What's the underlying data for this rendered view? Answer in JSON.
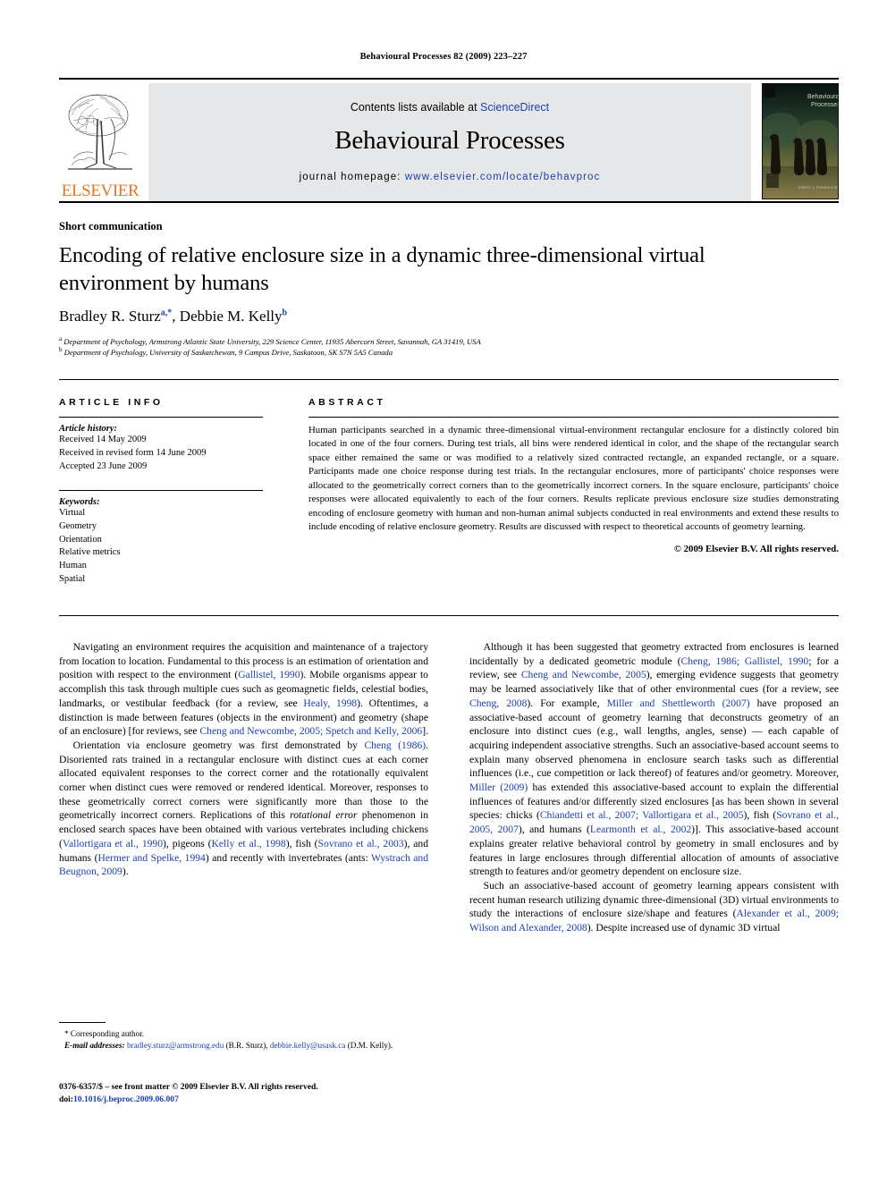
{
  "running_head": "Behavioural Processes 82 (2009) 223–227",
  "masthead": {
    "contents_prefix": "Contents lists available at ",
    "sciencedirect": "ScienceDirect",
    "journal_title": "Behavioural Processes",
    "homepage_label": "journal homepage:",
    "homepage_url": "www.elsevier.com/locate/behavproc",
    "publisher": "ELSEVIER",
    "cover_title_line1": "Behavioural",
    "cover_title_line2": "Processes",
    "accent_orange": "#E87722",
    "link_blue": "#1b3fae",
    "band_gray": "#e6e7e8"
  },
  "article": {
    "type": "Short communication",
    "title": "Encoding of relative enclosure size in a dynamic three-dimensional virtual environment by humans",
    "authors_html": "Bradley R. Sturz<sup>a,*</sup>, Debbie M. Kelly<sup>b</sup>",
    "affiliation_a": "Department of Psychology, Armstrong Atlantic State University, 229 Science Center, 11935 Abercorn Street, Savannah, GA 31419, USA",
    "affiliation_b": "Department of Psychology, University of Saskatchewan, 9 Campus Drive, Saskatoon, SK S7N 5A5 Canada"
  },
  "info": {
    "heading": "ARTICLE INFO",
    "history_label": "Article history:",
    "history": [
      "Received 14 May 2009",
      "Received in revised form 14 June 2009",
      "Accepted 23 June 2009"
    ],
    "keywords_label": "Keywords:",
    "keywords": [
      "Virtual",
      "Geometry",
      "Orientation",
      "Relative metrics",
      "Human",
      "Spatial"
    ]
  },
  "abstract": {
    "heading": "ABSTRACT",
    "text": "Human participants searched in a dynamic three-dimensional virtual-environment rectangular enclosure for a distinctly colored bin located in one of the four corners. During test trials, all bins were rendered identical in color, and the shape of the rectangular search space either remained the same or was modified to a relatively sized contracted rectangle, an expanded rectangle, or a square. Participants made one choice response during test trials. In the rectangular enclosures, more of participants' choice responses were allocated to the geometrically correct corners than to the geometrically incorrect corners. In the square enclosure, participants' choice responses were allocated equivalently to each of the four corners. Results replicate previous enclosure size studies demonstrating encoding of enclosure geometry with human and non-human animal subjects conducted in real environments and extend these results to include encoding of relative enclosure geometry. Results are discussed with respect to theoretical accounts of geometry learning.",
    "copyright": "© 2009 Elsevier B.V. All rights reserved."
  },
  "body": {
    "left": [
      {
        "id": "para-navigating",
        "html": "Navigating an environment requires the acquisition and maintenance of a trajectory from location to location. Fundamental to this process is an estimation of orientation and position with respect to the environment (<span class=\"ref\">Gallistel, 1990</span>). Mobile organisms appear to accomplish this task through multiple cues such as geomagnetic fields, celestial bodies, landmarks, or vestibular feedback (for a review, see <span class=\"ref\">Healy, 1998</span>). Oftentimes, a distinction is made between features (objects in the environment) and geometry (shape of an enclosure) [for reviews, see <span class=\"ref\">Cheng and Newcombe, 2005; Spetch and Kelly, 2006</span>]."
      },
      {
        "id": "para-orientation",
        "html": "Orientation via enclosure geometry was first demonstrated by <span class=\"ref\">Cheng (1986)</span>. Disoriented rats trained in a rectangular enclosure with distinct cues at each corner allocated equivalent responses to the correct corner and the rotationally equivalent corner when distinct cues were removed or rendered identical. Moreover, responses to these geometrically correct corners were significantly more than those to the geometrically incorrect corners. Replications of this <span class=\"ital\">rotational error</span> phenomenon in enclosed search spaces have been obtained with various vertebrates including chickens (<span class=\"ref\">Vallortigara et al., 1990</span>), pigeons (<span class=\"ref\">Kelly et al., 1998</span>), fish (<span class=\"ref\">Sovrano et al., 2003</span>), and humans (<span class=\"ref\">Hermer and Spelke, 1994</span>) and recently with invertebrates (ants: <span class=\"ref\">Wystrach and Beugnon, 2009</span>)."
      }
    ],
    "right": [
      {
        "id": "para-although",
        "html": "Although it has been suggested that geometry extracted from enclosures is learned incidentally by a dedicated geometric module (<span class=\"ref\">Cheng, 1986; Gallistel, 1990</span>; for a review, see <span class=\"ref\">Cheng and Newcombe, 2005</span>), emerging evidence suggests that geometry may be learned associatively like that of other environmental cues (for a review, see <span class=\"ref\">Cheng, 2008</span>). For example, <span class=\"ref\">Miller and Shettleworth (2007)</span> have proposed an associative-based account of geometry learning that deconstructs geometry of an enclosure into distinct cues (e.g., wall lengths, angles, sense) — each capable of acquiring independent associative strengths. Such an associative-based account seems to explain many observed phenomena in enclosure search tasks such as differential influences (i.e., cue competition or lack thereof) of features and/or geometry. Moreover, <span class=\"ref\">Miller (2009)</span> has extended this associative-based account to explain the differential influences of features and/or differently sized enclosures [as has been shown in several species: chicks (<span class=\"ref\">Chiandetti et al., 2007; Vallortigara et al., 2005</span>), fish (<span class=\"ref\">Sovrano et al., 2005, 2007</span>), and humans (<span class=\"ref\">Learmonth et al., 2002</span>)]. This associative-based account explains greater relative behavioral control by geometry in small enclosures and by features in large enclosures through differential allocation of amounts of associative strength to features and/or geometry dependent on enclosure size."
      },
      {
        "id": "para-such",
        "html": "Such an associative-based account of geometry learning appears consistent with recent human research utilizing dynamic three-dimensional (3D) virtual environments to study the interactions of enclosure size/shape and features (<span class=\"ref\">Alexander et al., 2009; Wilson and Alexander, 2008</span>). Despite increased use of dynamic 3D virtual"
      }
    ]
  },
  "footnote": {
    "corresponding": "* Corresponding author.",
    "email_label": "E-mail addresses:",
    "email_1": "bradley.sturz@armstrong.edu",
    "email_1_owner": "(B.R. Sturz),",
    "email_2": "debbie.kelly@usask.ca",
    "email_2_owner": "(D.M. Kelly)."
  },
  "imprint": {
    "line1": "0376-6357/$ – see front matter © 2009 Elsevier B.V. All rights reserved.",
    "doi_label": "doi:",
    "doi_value": "10.1016/j.beproc.2009.06.007"
  }
}
